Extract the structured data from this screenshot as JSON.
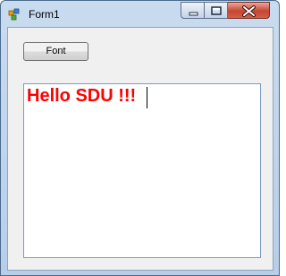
{
  "window": {
    "title": "Form1",
    "icon": "winforms-app-icon",
    "controls": {
      "minimize": "minimize-icon",
      "maximize": "maximize-icon",
      "close": "close-icon"
    }
  },
  "toolbar": {
    "font_label": "Font"
  },
  "editor": {
    "text": "Hello SDU !!!",
    "text_color": "#ff0000"
  }
}
